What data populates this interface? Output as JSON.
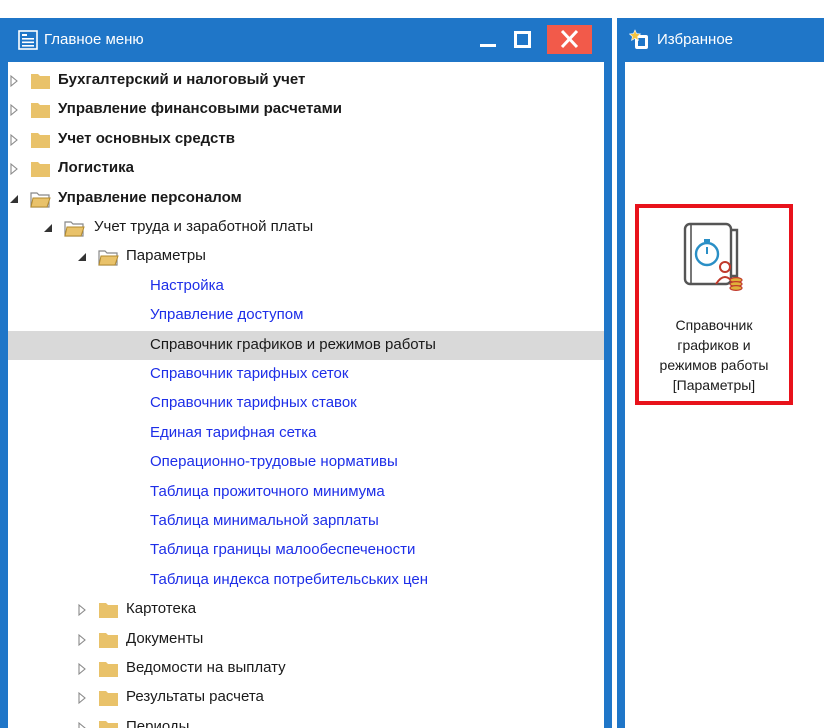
{
  "main_menu": {
    "title": "Главное меню",
    "items": [
      {
        "label": "Бухгалтерский и налоговый учет",
        "style": "bold",
        "level": 0,
        "expanded": false
      },
      {
        "label": "Управление финансовыми расчетами",
        "style": "bold",
        "level": 0,
        "expanded": false
      },
      {
        "label": "Учет основных средств",
        "style": "bold",
        "level": 0,
        "expanded": false
      },
      {
        "label": "Логистика",
        "style": "bold",
        "level": 0,
        "expanded": false
      },
      {
        "label": "Управление персоналом",
        "style": "bold",
        "level": 0,
        "expanded": true
      },
      {
        "label": "Учет труда и заработной платы",
        "style": "plain",
        "level": 1,
        "expanded": true
      },
      {
        "label": "Параметры",
        "style": "plain",
        "level": 2,
        "expanded": true
      },
      {
        "label": "Настройка",
        "style": "link",
        "level": 3
      },
      {
        "label": "Управление доступом",
        "style": "link",
        "level": 3
      },
      {
        "label": "Справочник графиков и режимов работы",
        "style": "plain",
        "level": 3,
        "selected": true
      },
      {
        "label": "Справочник тарифных сеток",
        "style": "link",
        "level": 3
      },
      {
        "label": "Справочник тарифных ставок",
        "style": "link",
        "level": 3
      },
      {
        "label": "Единая тарифная сетка",
        "style": "link",
        "level": 3
      },
      {
        "label": "Операционно-трудовые нормативы",
        "style": "link",
        "level": 3
      },
      {
        "label": "Таблица прожиточного минимума",
        "style": "link",
        "level": 3
      },
      {
        "label": "Таблица минимальной зарплаты",
        "style": "link",
        "level": 3
      },
      {
        "label": "Таблица границы малообеспечености",
        "style": "link",
        "level": 3
      },
      {
        "label": "Таблица индекса потребительських цен",
        "style": "link",
        "level": 3
      },
      {
        "label": "Картотека",
        "style": "plain",
        "level": 2,
        "expanded": false
      },
      {
        "label": "Документы",
        "style": "plain",
        "level": 2,
        "expanded": false
      },
      {
        "label": "Ведомости на выплату",
        "style": "plain",
        "level": 2,
        "expanded": false
      },
      {
        "label": "Результаты расчета",
        "style": "plain",
        "level": 2,
        "expanded": false
      },
      {
        "label": "Периоды",
        "style": "plain",
        "level": 2,
        "expanded": false
      }
    ]
  },
  "favorites": {
    "title": "Избранное",
    "tile": {
      "line1": "Справочник",
      "line2": "графиков и",
      "line3": "режимов работы",
      "line4": "[Параметры]"
    }
  },
  "icons": {
    "title": "menu-list-icon",
    "minimize": "minimize-icon",
    "maximize": "maximize-icon",
    "close": "close-icon",
    "favorites": "favorites-icon",
    "tile": "stopwatch-personnel-icon"
  },
  "colors": {
    "titlebar": "#1f76c8",
    "close": "#f25a4a",
    "link": "#1d2ee8",
    "selected_row": "#d9d9d9",
    "highlight_border": "#e8121b",
    "folder": "#e9c26a"
  }
}
